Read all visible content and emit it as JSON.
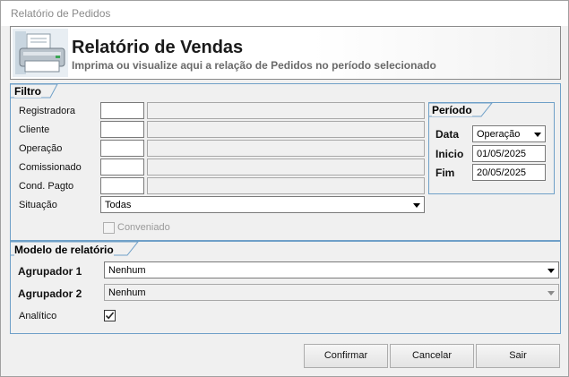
{
  "window": {
    "title": "Relatório de Pedidos"
  },
  "header": {
    "title": "Relatório de Vendas",
    "subtitle": "Imprima ou visualize aqui a relação de Pedidos no período selecionado",
    "icon": "printer-icon"
  },
  "filtro": {
    "group_label": "Filtro",
    "registradora_label": "Registradora",
    "cliente_label": "Cliente",
    "operacao_label": "Operação",
    "comissionado_label": "Comissionado",
    "cond_pagto_label": "Cond. Pagto",
    "situacao_label": "Situação",
    "situacao_value": "Todas",
    "conveniado_label": "Conveniado"
  },
  "periodo": {
    "group_label": "Período",
    "data_label": "Data",
    "data_value": "Operação",
    "inicio_label": "Inicio",
    "inicio_value": "01/05/2025",
    "fim_label": "Fim",
    "fim_value": "20/05/2025"
  },
  "modelo": {
    "group_label": "Modelo de relatório",
    "agrupador1_label": "Agrupador 1",
    "agrupador1_value": "Nenhum",
    "agrupador2_label": "Agrupador 2",
    "agrupador2_value": "Nenhum",
    "analitico_label": "Analítico",
    "analitico_checked": true
  },
  "buttons": {
    "confirmar": "Confirmar",
    "cancelar": "Cancelar",
    "sair": "Sair"
  }
}
